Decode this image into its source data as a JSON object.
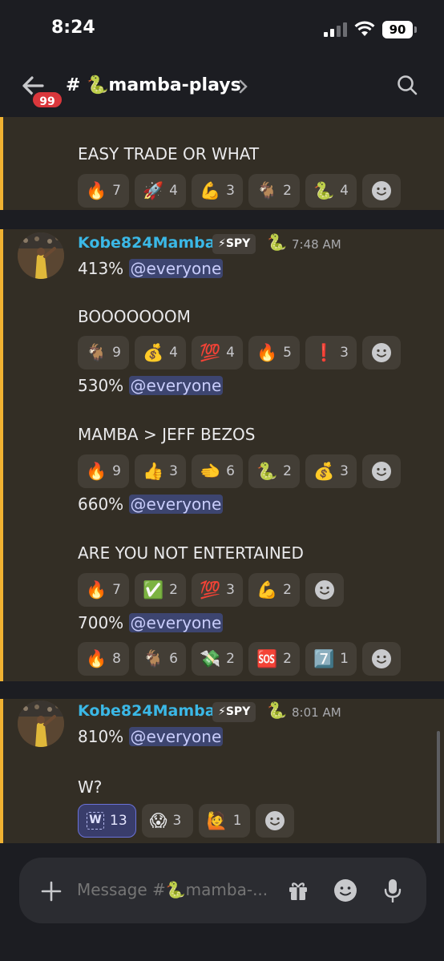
{
  "status_bar": {
    "time": "8:24",
    "battery": "90"
  },
  "header": {
    "back_badge": "99",
    "hash": "#",
    "channel_name": "🐍mamba-plays",
    "chevron": "›"
  },
  "colors": {
    "accent": "#f0b232",
    "username": "#3bb8e6",
    "mention_bg": "#3d4570",
    "badge": "#da373c"
  },
  "messages": {
    "m0": {
      "text": "EASY TRADE OR WHAT",
      "reactions": [
        {
          "emoji": "🔥",
          "count": "7"
        },
        {
          "emoji": "🚀",
          "count": "4"
        },
        {
          "emoji": "💪",
          "count": "3"
        },
        {
          "emoji": "🐐",
          "count": "2"
        },
        {
          "emoji": "🐍",
          "count": "4"
        }
      ]
    },
    "g1": {
      "username": "Kobe824Mamba",
      "tag": "⚡SPY",
      "badge": "🐍",
      "timestamp": "7:48 AM",
      "lines": [
        {
          "pct": "413%",
          "mention": "@everyone"
        },
        {
          "text": "BOOOOOOOM"
        },
        {
          "pct": "530%",
          "mention": "@everyone"
        },
        {
          "text": "MAMBA > JEFF BEZOS"
        },
        {
          "pct": "660%",
          "mention": "@everyone"
        },
        {
          "text": "ARE YOU NOT ENTERTAINED"
        },
        {
          "pct": "700%",
          "mention": "@everyone"
        }
      ],
      "reactions_a": [
        {
          "emoji": "🐐",
          "count": "9"
        },
        {
          "emoji": "💰",
          "count": "4"
        },
        {
          "emoji": "💯",
          "count": "4"
        },
        {
          "emoji": "🔥",
          "count": "5"
        },
        {
          "emoji": "❗",
          "count": "3"
        }
      ],
      "reactions_b": [
        {
          "emoji": "🔥",
          "count": "9"
        },
        {
          "emoji": "👍",
          "count": "3"
        },
        {
          "emoji": "🫲",
          "count": "6"
        },
        {
          "emoji": "🐍",
          "count": "2"
        },
        {
          "emoji": "💰",
          "count": "3"
        }
      ],
      "reactions_c": [
        {
          "emoji": "🔥",
          "count": "7"
        },
        {
          "emoji": "✅",
          "count": "2"
        },
        {
          "emoji": "💯",
          "count": "3"
        },
        {
          "emoji": "💪",
          "count": "2"
        }
      ],
      "reactions_d": [
        {
          "emoji": "🔥",
          "count": "8"
        },
        {
          "emoji": "🐐",
          "count": "6"
        },
        {
          "emoji": "💸",
          "count": "2"
        },
        {
          "emoji": "🆘",
          "count": "2"
        },
        {
          "emoji": "7️⃣",
          "count": "1"
        }
      ]
    },
    "g2": {
      "username": "Kobe824Mamba",
      "tag": "⚡SPY",
      "badge": "🐍",
      "timestamp": "8:01 AM",
      "lines": [
        {
          "pct": "810%",
          "mention": "@everyone"
        },
        {
          "text": "W?"
        }
      ],
      "reactions": [
        {
          "emoji": "W",
          "count": "13"
        },
        {
          "emoji": "😱",
          "count": "3"
        },
        {
          "emoji": "🙋",
          "count": "1"
        }
      ]
    }
  },
  "composer": {
    "placeholder": "Message #🐍mamba-..."
  }
}
